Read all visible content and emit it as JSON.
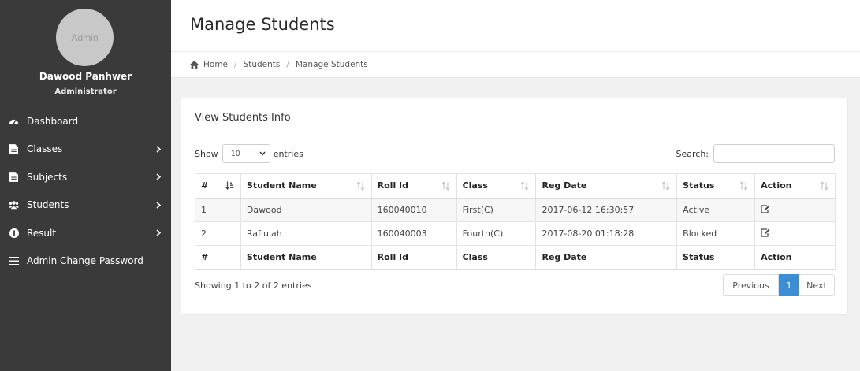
{
  "sidebar": {
    "avatar_text": "Admin",
    "user_name": "Dawood Panhwer",
    "user_role": "Administrator",
    "items": [
      {
        "label": "Dashboard",
        "icon": "dashboard-icon",
        "has_submenu": false
      },
      {
        "label": "Classes",
        "icon": "file-icon",
        "has_submenu": true
      },
      {
        "label": "Subjects",
        "icon": "file-icon",
        "has_submenu": true
      },
      {
        "label": "Students",
        "icon": "users-icon",
        "has_submenu": true
      },
      {
        "label": "Result",
        "icon": "info-icon",
        "has_submenu": true
      },
      {
        "label": "Admin Change Password",
        "icon": "list-icon",
        "has_submenu": false
      }
    ]
  },
  "header": {
    "title": "Manage Students"
  },
  "breadcrumb": {
    "items": [
      "Home",
      "Students",
      "Manage Students"
    ]
  },
  "panel": {
    "title": "View Students Info",
    "show_label": "Show",
    "entries_value": "10",
    "entries_label": "entries",
    "search_label": "Search:",
    "search_value": ""
  },
  "table": {
    "columns": [
      "#",
      "Student Name",
      "Roll Id",
      "Class",
      "Reg Date",
      "Status",
      "Action"
    ],
    "rows": [
      [
        "1",
        "Dawood",
        "160040010",
        "First(C)",
        "2017-06-12 16:30:57",
        "Active"
      ],
      [
        "2",
        "Rafiulah",
        "160040003",
        "Fourth(C)",
        "2017-08-20 01:18:28",
        "Blocked"
      ]
    ]
  },
  "footer": {
    "info": "Showing 1 to 2 of 2 entries",
    "prev_label": "Previous",
    "page_label": "1",
    "next_label": "Next"
  },
  "colors": {
    "sidebar_bg": "#3a3a3a",
    "accent": "#3c8dd4",
    "page_bg": "#f1f1f1"
  }
}
